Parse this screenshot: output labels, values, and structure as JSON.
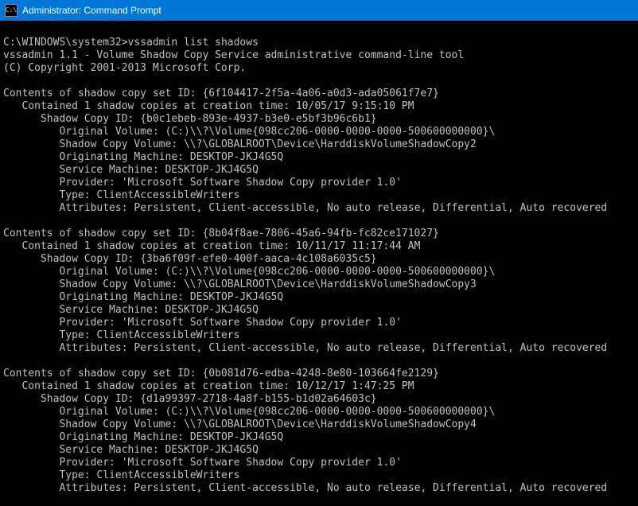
{
  "window": {
    "title": "Administrator: Command Prompt",
    "icon_glyph": "C:\\"
  },
  "prompt": {
    "path": "C:\\WINDOWS\\system32>",
    "command": "vssadmin list shadows"
  },
  "header": {
    "tool_line": "vssadmin 1.1 - Volume Shadow Copy Service administrative command-line tool",
    "copyright": "(C) Copyright 2001-2013 Microsoft Corp."
  },
  "sets": [
    {
      "set_id": "{6f104417-2f5a-4a06-a0d3-ada05061f7e7}",
      "contained": "1",
      "creation_time": "10/05/17 9:15:10 PM",
      "copy_id": "{b0c1ebeb-893e-4937-b3e0-e5bf3b96c6b1}",
      "original_volume": "(C:)\\\\?\\Volume{098cc206-0000-0000-0000-500600000000}\\",
      "shadow_copy_volume": "\\\\?\\GLOBALROOT\\Device\\HarddiskVolumeShadowCopy2",
      "originating_machine": "DESKTOP-JKJ4G5Q",
      "service_machine": "DESKTOP-JKJ4G5Q",
      "provider": "'Microsoft Software Shadow Copy provider 1.0'",
      "type": "ClientAccessibleWriters",
      "attributes": "Persistent, Client-accessible, No auto release, Differential, Auto recovered"
    },
    {
      "set_id": "{8b04f8ae-7806-45a6-94fb-fc82ce171027}",
      "contained": "1",
      "creation_time": "10/11/17 11:17:44 AM",
      "copy_id": "{3ba6f09f-efe0-400f-aaca-4c108a6035c5}",
      "original_volume": "(C:)\\\\?\\Volume{098cc206-0000-0000-0000-500600000000}\\",
      "shadow_copy_volume": "\\\\?\\GLOBALROOT\\Device\\HarddiskVolumeShadowCopy3",
      "originating_machine": "DESKTOP-JKJ4G5Q",
      "service_machine": "DESKTOP-JKJ4G5Q",
      "provider": "'Microsoft Software Shadow Copy provider 1.0'",
      "type": "ClientAccessibleWriters",
      "attributes": "Persistent, Client-accessible, No auto release, Differential, Auto recovered"
    },
    {
      "set_id": "{0b081d76-edba-4248-8e80-103664fe2129}",
      "contained": "1",
      "creation_time": "10/12/17 1:47:25 PM",
      "copy_id": "{d1a99397-2718-4a8f-b155-b1d02a64603c}",
      "original_volume": "(C:)\\\\?\\Volume{098cc206-0000-0000-0000-500600000000}\\",
      "shadow_copy_volume": "\\\\?\\GLOBALROOT\\Device\\HarddiskVolumeShadowCopy4",
      "originating_machine": "DESKTOP-JKJ4G5Q",
      "service_machine": "DESKTOP-JKJ4G5Q",
      "provider": "'Microsoft Software Shadow Copy provider 1.0'",
      "type": "ClientAccessibleWriters",
      "attributes": "Persistent, Client-accessible, No auto release, Differential, Auto recovered"
    }
  ],
  "labels": {
    "contents_prefix": "Contents of shadow copy set ID: ",
    "contained_prefix": "   Contained ",
    "contained_suffix": " shadow copies at creation time: ",
    "copy_id_prefix": "      Shadow Copy ID: ",
    "orig_vol_prefix": "         Original Volume: ",
    "scv_prefix": "         Shadow Copy Volume: ",
    "orig_mach_prefix": "         Originating Machine: ",
    "svc_mach_prefix": "         Service Machine: ",
    "provider_prefix": "         Provider: ",
    "type_prefix": "         Type: ",
    "attr_prefix": "         Attributes: "
  }
}
